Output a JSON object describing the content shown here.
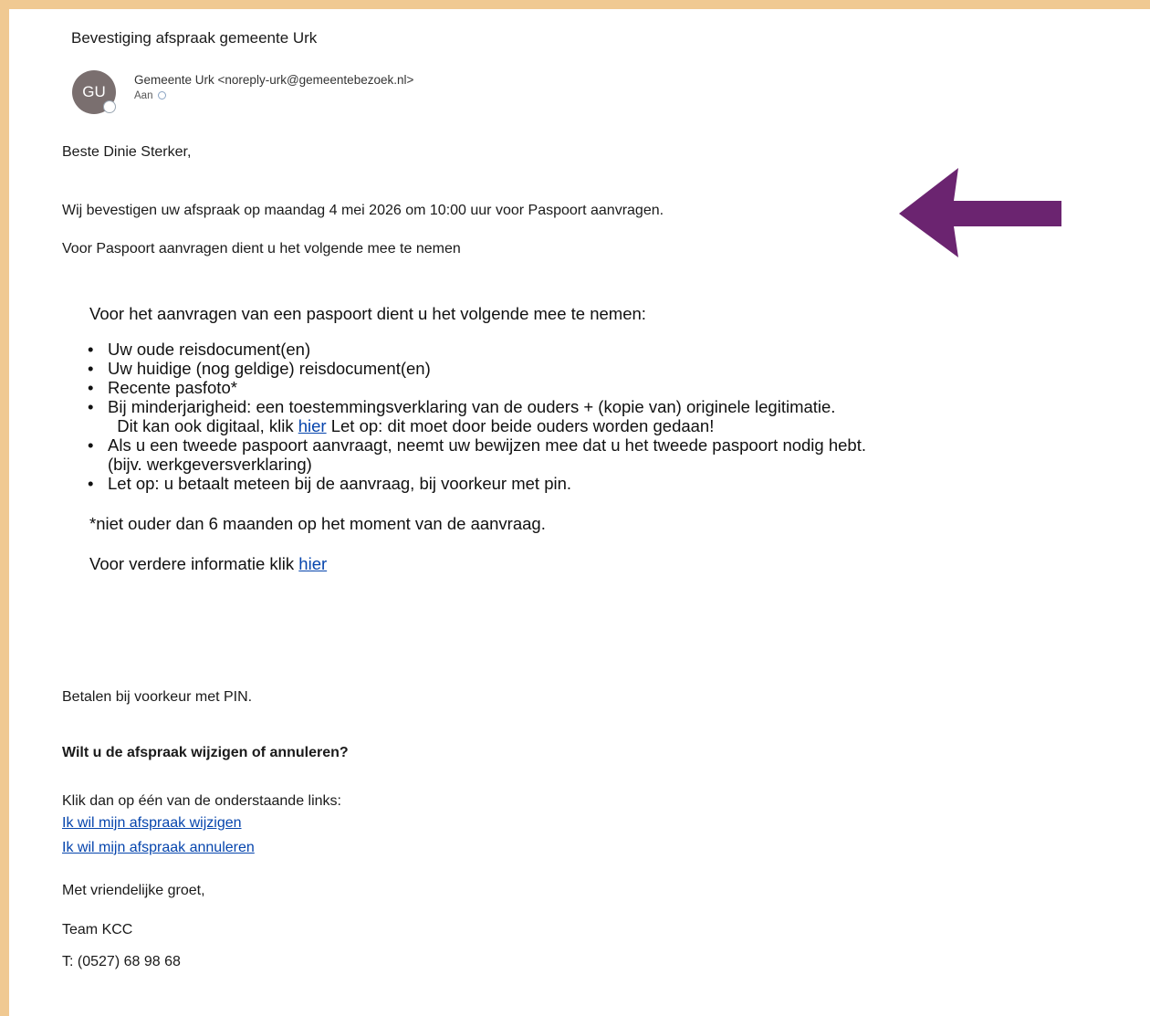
{
  "email": {
    "subject": "Bevestiging afspraak gemeente Urk",
    "avatar_initials": "GU",
    "sender": "Gemeente Urk <noreply-urk@gemeentebezoek.nl>",
    "to_label": "Aan"
  },
  "body": {
    "greeting": "Beste Dinie Sterker,",
    "confirmation": "Wij bevestigen uw afspraak op maandag 4 mei 2026 om 10:00 uur voor Paspoort aanvragen.",
    "intro": "Voor Paspoort aanvragen dient u het volgende mee te nemen",
    "requirements": {
      "lead": "Voor het aanvragen van een paspoort dient u het volgende mee te nemen:",
      "items": [
        "Uw oude reisdocument(en)",
        "Uw huidige (nog geldige) reisdocument(en)",
        "Recente pasfoto*"
      ],
      "minor_item": "Bij minderjarigheid: een toestemmingsverklaring van de ouders + (kopie van) originele legitimatie.",
      "minor_digital_pre": "Dit kan ook digitaal, klik",
      "minor_link": "hier",
      "minor_digital_post": "Let op: dit moet door beide ouders worden gedaan!",
      "second_passport_item": "Als u een tweede paspoort aanvraagt, neemt uw bewijzen mee dat u het tweede paspoort nodig hebt.",
      "second_passport_note": "(bijv. werkgeversverklaring)",
      "payment_item": "Let op: u betaalt meteen bij de aanvraag, bij voorkeur met pin.",
      "footnote": "*niet ouder dan 6 maanden op het moment van de aanvraag.",
      "more_info_pre": "Voor verdere informatie klik",
      "more_info_link": "hier"
    },
    "pay_note": "Betalen bij voorkeur met PIN.",
    "change_heading": "Wilt u de afspraak wijzigen of annuleren?",
    "click_text": "Klik dan op één van de onderstaande links:",
    "change_link": "Ik wil mijn afspraak wijzigen",
    "cancel_link": "Ik wil mijn afspraak annuleren",
    "regards": "Met vriendelijke groet,",
    "team": "Team KCC",
    "phone": "T: (0527) 68 98 68"
  },
  "colors": {
    "frame": "#f0c992",
    "arrow": "#6b2470",
    "avatar": "#7a6f6f",
    "link": "#0645ad"
  },
  "icons": {
    "arrow": "left-arrow-annotation"
  }
}
